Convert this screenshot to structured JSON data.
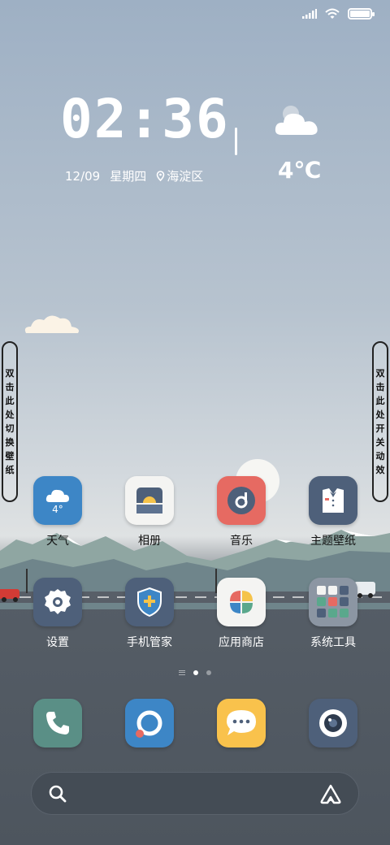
{
  "status_bar": {
    "icons": [
      "signal-icon",
      "wifi-icon",
      "battery-icon"
    ],
    "battery_level": 1.0
  },
  "clock_widget": {
    "time": "02:36",
    "date": "12/09",
    "weekday": "星期四",
    "location": "海淀区",
    "weather_icon": "cloud-icon",
    "temperature": "4℃"
  },
  "side_tabs": {
    "left": {
      "label": "双击此处切换壁纸",
      "chars": [
        "双",
        "击",
        "此",
        "处",
        "切",
        "换",
        "壁",
        "纸"
      ]
    },
    "right": {
      "label": "双击此处开关动效",
      "chars": [
        "双",
        "击",
        "此",
        "处",
        "开",
        "关",
        "动",
        "效"
      ]
    }
  },
  "apps": [
    {
      "label": "天气",
      "icon": "weather-icon",
      "badge": "4°",
      "color": "#3d86c6"
    },
    {
      "label": "相册",
      "icon": "gallery-icon",
      "color": "#f4f4f2"
    },
    {
      "label": "音乐",
      "icon": "music-icon",
      "color": "#e66a62"
    },
    {
      "label": "主题壁纸",
      "icon": "theme-icon",
      "color": "#4e607a"
    },
    {
      "label": "设置",
      "icon": "settings-icon",
      "color": "#4e607a"
    },
    {
      "label": "手机管家",
      "icon": "security-icon",
      "color": "#4e607a"
    },
    {
      "label": "应用商店",
      "icon": "app-store-icon",
      "color": "#f4f4f2"
    },
    {
      "label": "系统工具",
      "icon": "folder-icon",
      "color": "#8c96a3"
    }
  ],
  "page_indicator": {
    "pages": 2,
    "current": 1
  },
  "dock": [
    {
      "icon": "phone-icon",
      "color": "#5a8f86"
    },
    {
      "icon": "browser-icon",
      "color": "#3d86c6"
    },
    {
      "icon": "messages-icon",
      "color": "#f9c24c"
    },
    {
      "icon": "camera-icon",
      "color": "#4e607a"
    }
  ],
  "search_bar": {
    "left_icon": "search-icon",
    "right_icon": "assistant-icon"
  }
}
